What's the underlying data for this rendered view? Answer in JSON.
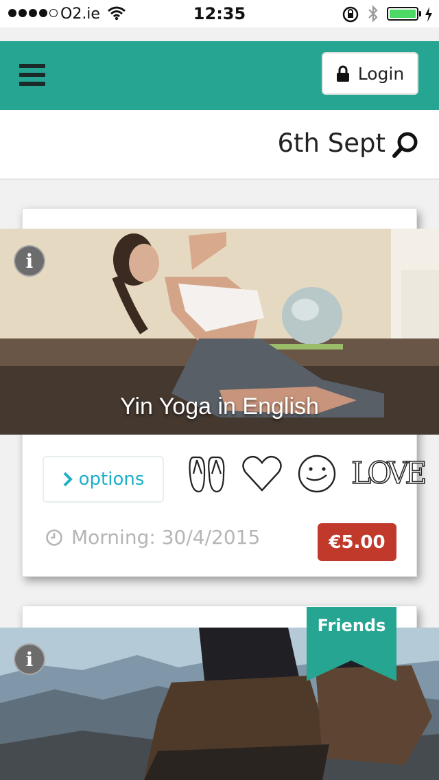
{
  "status_bar": {
    "carrier": "O2.ie",
    "time": "12:35",
    "battery_color": "#4cd964"
  },
  "header": {
    "background": "#26a592",
    "menu_icon": "hamburger-icon",
    "login_label": "Login",
    "login_icon": "lock-icon"
  },
  "date_bar": {
    "date": "6th Sept",
    "search_icon": "search-icon"
  },
  "events": [
    {
      "title": "Yin Yoga in English",
      "options_label": "options",
      "feature_icons": [
        "flip-flops-icon",
        "heart-icon",
        "smiley-icon",
        "love-icon"
      ],
      "love_text": "LOVE",
      "time": "Morning: 30/4/2015",
      "price": "€5.00",
      "price_color": "#c0392b"
    },
    {
      "ribbon": "Friends",
      "ribbon_color": "#26a592"
    }
  ]
}
